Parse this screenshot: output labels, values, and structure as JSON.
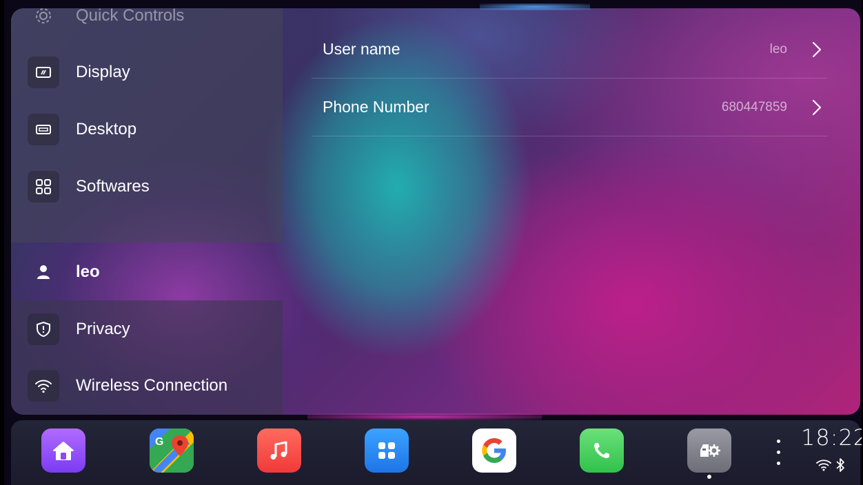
{
  "sidebar": {
    "items": [
      {
        "label": "Quick Controls",
        "icon": "gear-icon"
      },
      {
        "label": "Display",
        "icon": "display-icon"
      },
      {
        "label": "Desktop",
        "icon": "desktop-icon"
      },
      {
        "label": "Softwares",
        "icon": "apps-grid-icon"
      },
      {
        "label": "leo",
        "icon": "user-icon",
        "active": true
      },
      {
        "label": "Privacy",
        "icon": "shield-icon"
      },
      {
        "label": "Wireless Connection",
        "icon": "wifi-icon"
      }
    ]
  },
  "account": {
    "rows": [
      {
        "title": "User name",
        "value": "leo"
      },
      {
        "title": "Phone Number",
        "value": "680447859"
      }
    ]
  },
  "dock": {
    "apps": [
      {
        "name": "Home",
        "icon": "home-icon",
        "color": "#9b4dff"
      },
      {
        "name": "Maps",
        "icon": "maps-icon",
        "color": "#34a853"
      },
      {
        "name": "Music",
        "icon": "music-icon",
        "color": "#fb4a4a"
      },
      {
        "name": "App Library",
        "icon": "app-library-icon",
        "color": "#2f8df5"
      },
      {
        "name": "Google",
        "icon": "google-icon",
        "color": "#ffffff"
      },
      {
        "name": "Phone",
        "icon": "phone-icon",
        "color": "#4cd964"
      },
      {
        "name": "Car Settings",
        "icon": "car-settings-icon",
        "color": "#7a7a85",
        "running": true
      }
    ],
    "time": "18:22",
    "status": [
      "wifi-icon",
      "bluetooth-icon"
    ]
  }
}
